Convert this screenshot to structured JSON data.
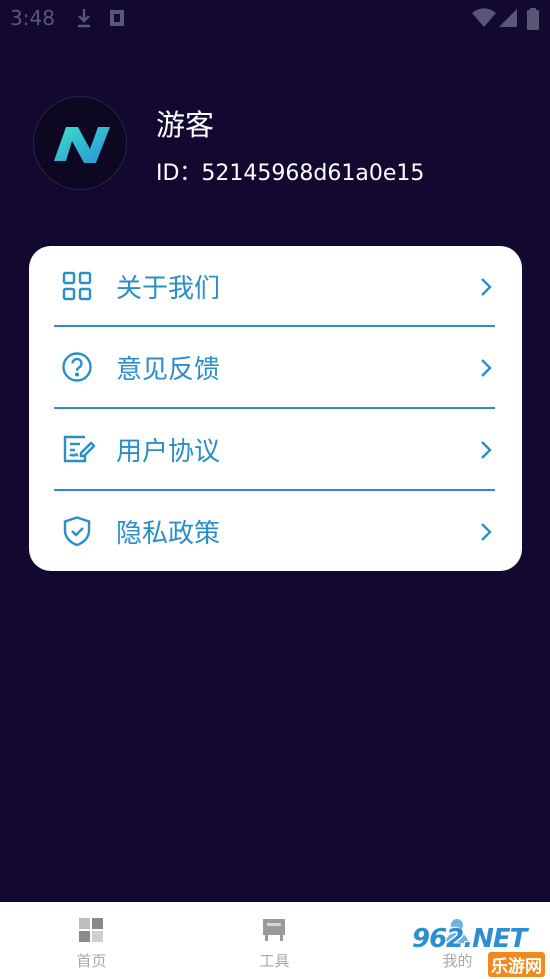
{
  "status_bar": {
    "time": "3:48",
    "icons": [
      "download-icon",
      "notification-icon",
      "wifi-icon",
      "signal-icon",
      "battery-icon"
    ]
  },
  "profile": {
    "name": "游客",
    "id_text": "ID：52145968d61a0e15"
  },
  "menu": {
    "items": [
      {
        "label": "关于我们",
        "icon": "grid-icon"
      },
      {
        "label": "意见反馈",
        "icon": "question-icon"
      },
      {
        "label": "用户协议",
        "icon": "document-edit-icon"
      },
      {
        "label": "隐私政策",
        "icon": "shield-check-icon"
      }
    ]
  },
  "tabbar": {
    "tabs": [
      {
        "label": "首页",
        "icon": "home-grid-icon"
      },
      {
        "label": "工具",
        "icon": "tools-icon"
      },
      {
        "label": "我的",
        "icon": "profile-icon"
      }
    ]
  },
  "watermark": {
    "brand": "962.NET",
    "sub": "乐游网"
  },
  "colors": {
    "background": "#13082f",
    "accent": "#2a8fc9",
    "card": "#ffffff"
  }
}
